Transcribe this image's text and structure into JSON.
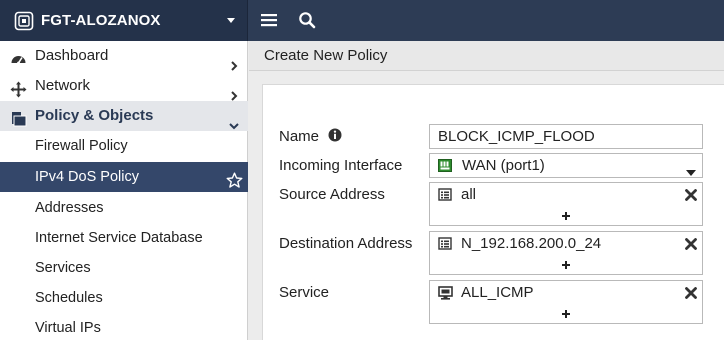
{
  "header": {
    "device_name": "FGT-ALOZANOX",
    "device_icon": "fortigate-device-icon",
    "menu_icon": "hamburger-menu-icon",
    "search_icon": "search-icon",
    "bar_color": "#2d3c55"
  },
  "sidebar": {
    "items": [
      {
        "label": "Dashboard",
        "icon": "dashboard-icon",
        "expand": "chevron-right"
      },
      {
        "label": "Network",
        "icon": "network-move-icon",
        "expand": "chevron-right"
      },
      {
        "label": "Policy & Objects",
        "icon": "policy-objects-icon",
        "expand": "chevron-down"
      }
    ],
    "subitems": [
      {
        "label": "Firewall Policy"
      },
      {
        "label": "IPv4 DoS Policy",
        "selected": true,
        "favorite_icon": "star-outline-icon"
      },
      {
        "label": "Addresses"
      },
      {
        "label": "Internet Service Database"
      },
      {
        "label": "Services"
      },
      {
        "label": "Schedules"
      },
      {
        "label": "Virtual IPs"
      }
    ],
    "selected_color": "#34476a"
  },
  "page": {
    "title": "Create New Policy"
  },
  "form": {
    "name": {
      "label": "Name",
      "value": "BLOCK_ICMP_FLOOD",
      "info_icon": "info-icon"
    },
    "incoming_interface": {
      "label": "Incoming Interface",
      "value": "WAN (port1)",
      "icon": "interface-port-icon"
    },
    "source_address": {
      "label": "Source Address",
      "value": "all",
      "icon": "address-object-icon"
    },
    "destination_address": {
      "label": "Destination Address",
      "value": "N_192.168.200.0_24",
      "icon": "address-object-icon"
    },
    "service": {
      "label": "Service",
      "value": "ALL_ICMP",
      "icon": "service-icon"
    }
  }
}
